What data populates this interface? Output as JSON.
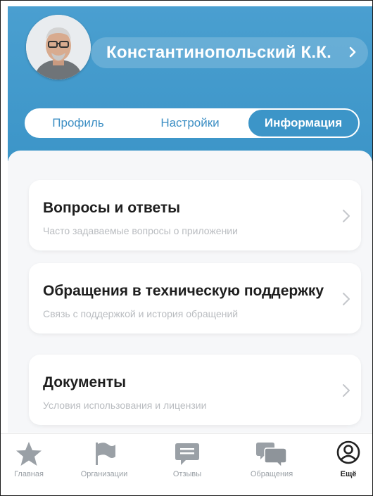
{
  "profile": {
    "name": "Константинопольский К.К."
  },
  "segments": [
    {
      "label": "Профиль",
      "active": false
    },
    {
      "label": "Настройки",
      "active": false
    },
    {
      "label": "Информация",
      "active": true
    }
  ],
  "cards": [
    {
      "title": "Вопросы и ответы",
      "subtitle": "Часто задаваемые вопросы о приложении"
    },
    {
      "title": "Обращения в техническую поддержку",
      "subtitle": "Связь с поддержкой и история обращений"
    },
    {
      "title": "Документы",
      "subtitle": "Условия использования и лицензии"
    }
  ],
  "tabbar": [
    {
      "label": "Главная",
      "icon": "star-icon",
      "active": false
    },
    {
      "label": "Организации",
      "icon": "flag-icon",
      "active": false
    },
    {
      "label": "Отзывы",
      "icon": "chat-icon",
      "active": false
    },
    {
      "label": "Обращения",
      "icon": "chats-icon",
      "active": false
    },
    {
      "label": "Ещё",
      "icon": "user-circle-icon",
      "active": true
    }
  ],
  "colors": {
    "header": "#3c95c8",
    "accent": "#3d8fc4",
    "card_title": "#1e1e1e",
    "card_subtitle": "#b9bcc0",
    "tab_inactive": "#9aa0a6"
  }
}
